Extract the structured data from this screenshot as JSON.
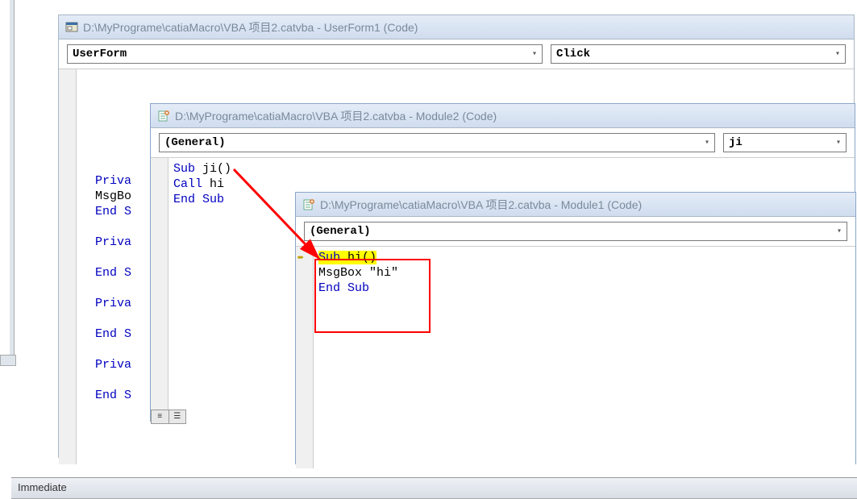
{
  "window1": {
    "title": "D:\\MyPrograme\\catiaMacro\\VBA 项目2.catvba - UserForm1 (Code)",
    "dropdown_left": "UserForm",
    "dropdown_right": "Click",
    "partial_lines": [
      {
        "kw": "Priva",
        "rest": ""
      },
      {
        "txt": "MsgBo"
      },
      {
        "kw": "End S",
        "rest": ""
      },
      {
        "gap": true
      },
      {
        "kw": "Priva"
      },
      {
        "gap": true
      },
      {
        "kw": "End S"
      },
      {
        "gap": true
      },
      {
        "kw": "Priva"
      },
      {
        "gap": true
      },
      {
        "kw": "End S"
      },
      {
        "gap": true
      },
      {
        "kw": "Priva"
      },
      {
        "gap": true
      },
      {
        "kw": "End S"
      }
    ]
  },
  "window2": {
    "title": "D:\\MyPrograme\\catiaMacro\\VBA 项目2.catvba - Module2 (Code)",
    "dropdown_left": "(General)",
    "dropdown_right": "ji",
    "code": {
      "line1_kw": "Sub",
      "line1_rest": " ji()",
      "line2_kw": "Call",
      "line2_rest": " hi",
      "line3_kw": "End Sub"
    }
  },
  "window3": {
    "title": "D:\\MyPrograme\\catiaMacro\\VBA 项目2.catvba - Module1 (Code)",
    "dropdown_left": "(General)",
    "code": {
      "line1_kw": "Sub",
      "line1_rest": " hi()",
      "line2_txt": "MsgBox \"hi\"",
      "line3_kw": "End Sub"
    }
  },
  "immediate": {
    "label": "Immediate"
  }
}
